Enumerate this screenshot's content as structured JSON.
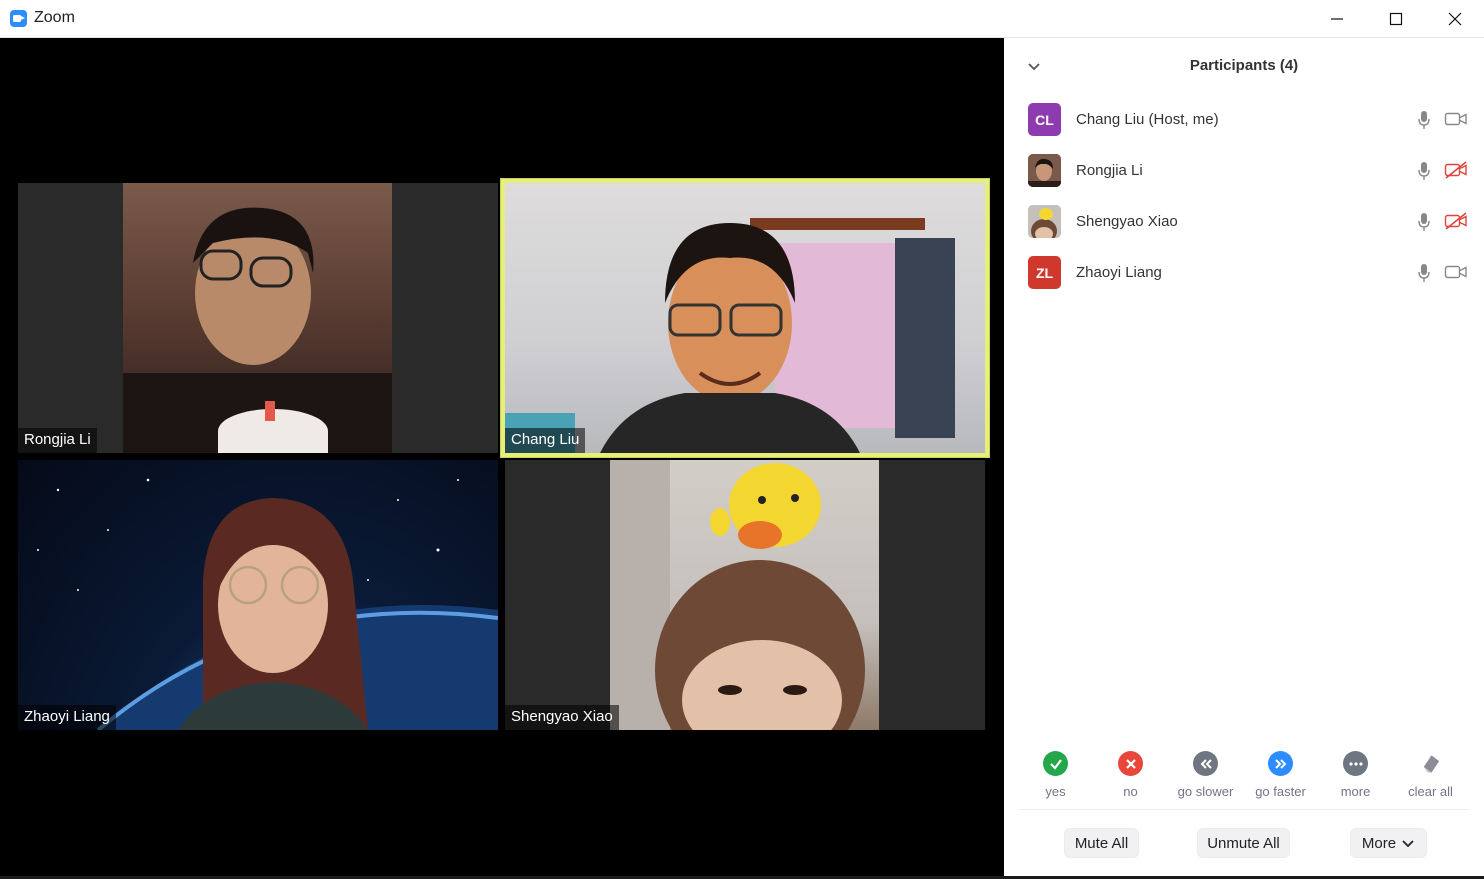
{
  "window": {
    "title": "Zoom"
  },
  "gallery": {
    "tiles": [
      {
        "name": "Rongjia Li"
      },
      {
        "name": "Chang Liu",
        "active": true
      },
      {
        "name": "Zhaoyi Liang"
      },
      {
        "name": "Shengyao Xiao"
      }
    ]
  },
  "participants_panel": {
    "title": "Participants (4)",
    "participants": [
      {
        "initials": "CL",
        "name": "Chang Liu (Host, me)",
        "avatar_color": "#8e3bb0",
        "mic": "on",
        "video": "on",
        "mic_icon": "mic-icon",
        "video_icon": "video-icon"
      },
      {
        "initials": "",
        "name": "Rongjia Li",
        "avatar_color": "#6b4a3e",
        "mic": "on",
        "video": "off",
        "mic_icon": "mic-icon",
        "video_icon": "video-off-icon"
      },
      {
        "initials": "",
        "name": "Shengyao Xiao",
        "avatar_color": "#9c8570",
        "mic": "on",
        "video": "off",
        "mic_icon": "mic-icon",
        "video_icon": "video-off-icon"
      },
      {
        "initials": "ZL",
        "name": "Zhaoyi Liang",
        "avatar_color": "#d0382e",
        "mic": "on",
        "video": "on",
        "mic_icon": "mic-icon",
        "video_icon": "video-icon"
      }
    ],
    "reactions": [
      {
        "label": "yes",
        "icon": "check-icon",
        "color": "#23a74a"
      },
      {
        "label": "no",
        "icon": "x-icon",
        "color": "#e8483a"
      },
      {
        "label": "go slower",
        "icon": "rewind-icon",
        "color": "#6e7682"
      },
      {
        "label": "go faster",
        "icon": "fast-forward-icon",
        "color": "#2d8cff"
      },
      {
        "label": "more",
        "icon": "more-icon",
        "color": "#6e7682"
      },
      {
        "label": "clear all",
        "icon": "eraser-icon",
        "color": "#8c8c99"
      }
    ],
    "footer": {
      "mute_all": "Mute All",
      "unmute_all": "Unmute All",
      "more": "More"
    }
  }
}
